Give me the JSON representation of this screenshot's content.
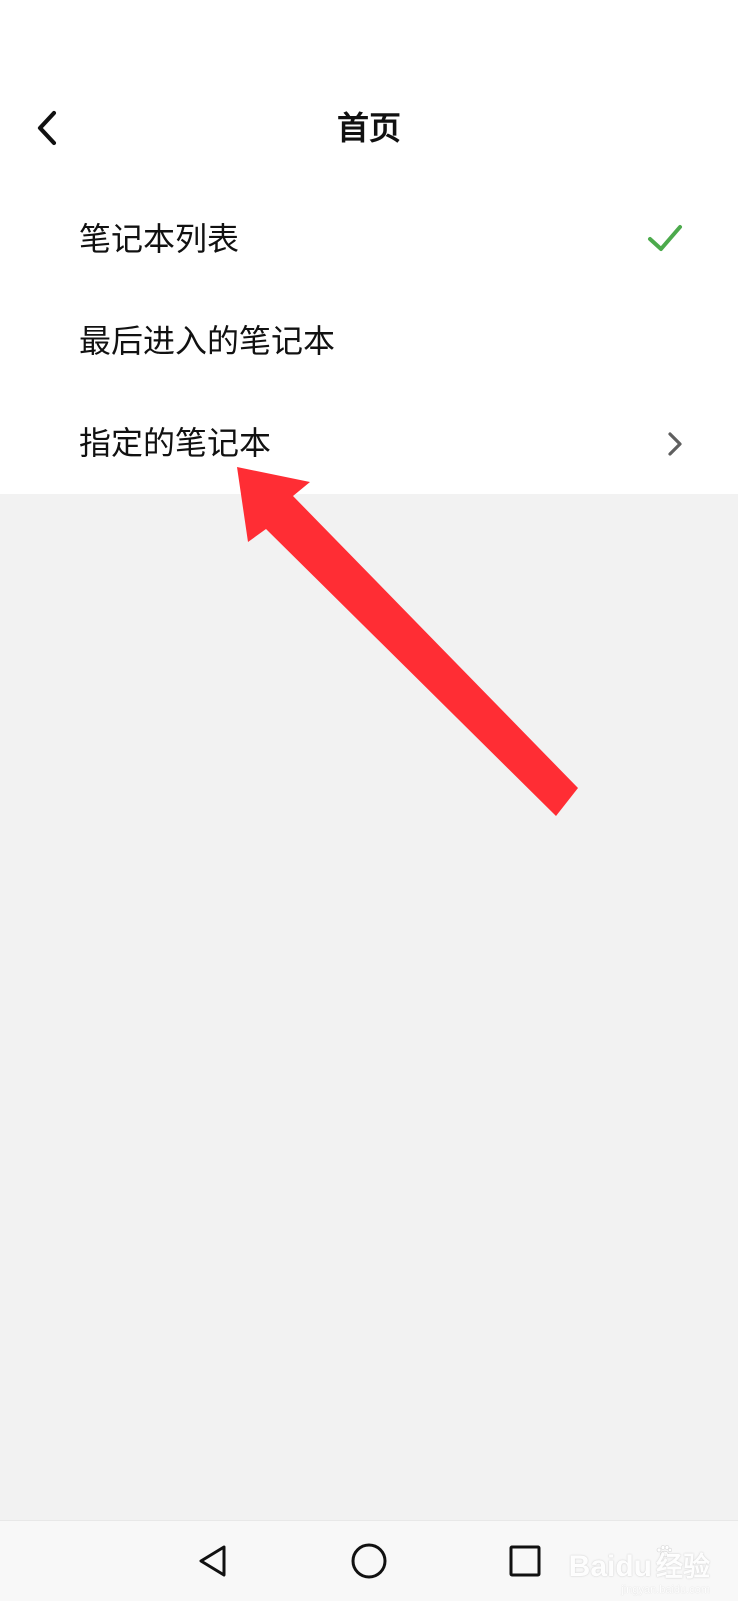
{
  "header": {
    "title": "首页",
    "back_icon": "chevron-left-icon"
  },
  "options": [
    {
      "label": "笔记本列表",
      "selected": true,
      "trailing_icon": "check-icon"
    },
    {
      "label": "最后进入的笔记本",
      "selected": false
    },
    {
      "label": "指定的笔记本",
      "selected": false,
      "trailing_icon": "chevron-right-icon"
    }
  ],
  "colors": {
    "accent_green": "#4caa4c",
    "annotation_red": "#ff2d34",
    "content_background": "#f2f2f2",
    "surface": "#ffffff",
    "text": "#111111"
  },
  "annotation": {
    "icon": "red-arrow-icon"
  },
  "navigation": {
    "back_icon": "triangle-back-icon",
    "home_icon": "circle-home-icon",
    "recents_icon": "square-recents-icon"
  },
  "watermark": {
    "brand": "Baidu",
    "product": "经验",
    "url": "jingyan.baidu.com"
  }
}
